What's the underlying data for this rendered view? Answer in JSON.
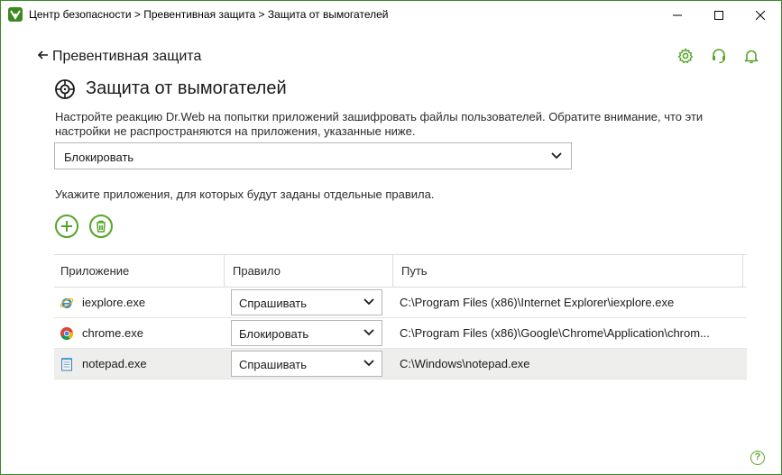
{
  "window": {
    "title": "Центр безопасности > Превентивная защита > Защита от вымогателей",
    "accent": "#55a52a",
    "controls": [
      "minimize",
      "maximize",
      "close"
    ]
  },
  "nav": {
    "back_label": "Превентивная защита"
  },
  "header_icons": [
    "gear-icon",
    "support-headset-icon",
    "notification-bell-icon"
  ],
  "page": {
    "title": "Защита от вымогателей",
    "description": "Настройте реакцию Dr.Web на попытки приложений зашифровать файлы пользователей. Обратите внимание, что эти настройки не распространяются на приложения, указанные ниже.",
    "reaction_value": "Блокировать",
    "apps_hint": "Укажите приложения, для которых будут заданы отдельные правила."
  },
  "table": {
    "headers": {
      "app": "Приложение",
      "rule": "Правило",
      "path": "Путь"
    },
    "rows": [
      {
        "app": "iexplore.exe",
        "icon": "internet-explorer-icon",
        "rule": "Спрашивать",
        "path": "C:\\Program Files (x86)\\Internet Explorer\\iexplore.exe"
      },
      {
        "app": "chrome.exe",
        "icon": "chrome-icon",
        "rule": "Блокировать",
        "path": "C:\\Program Files (x86)\\Google\\Chrome\\Application\\chrom..."
      },
      {
        "app": "notepad.exe",
        "icon": "notepad-icon",
        "rule": "Спрашивать",
        "path": "C:\\Windows\\notepad.exe",
        "selected": true
      }
    ]
  },
  "help": {
    "label": "?"
  }
}
